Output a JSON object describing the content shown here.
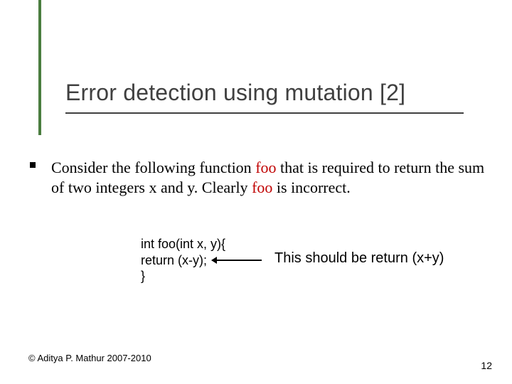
{
  "title": "Error detection using mutation [2]",
  "body": {
    "pre1": "Consider the following function ",
    "foo1": "foo",
    "mid1": " that is required to return the sum of two integers x and y. Clearly ",
    "foo2": "foo",
    "post1": " is incorrect."
  },
  "code": {
    "l1": "int foo(int x, y){",
    "l2": "return (x-y);",
    "l3": "}"
  },
  "note": "This should be return (x+y)",
  "footer": {
    "left": "© Aditya P. Mathur 2007-2010",
    "right": "12"
  }
}
